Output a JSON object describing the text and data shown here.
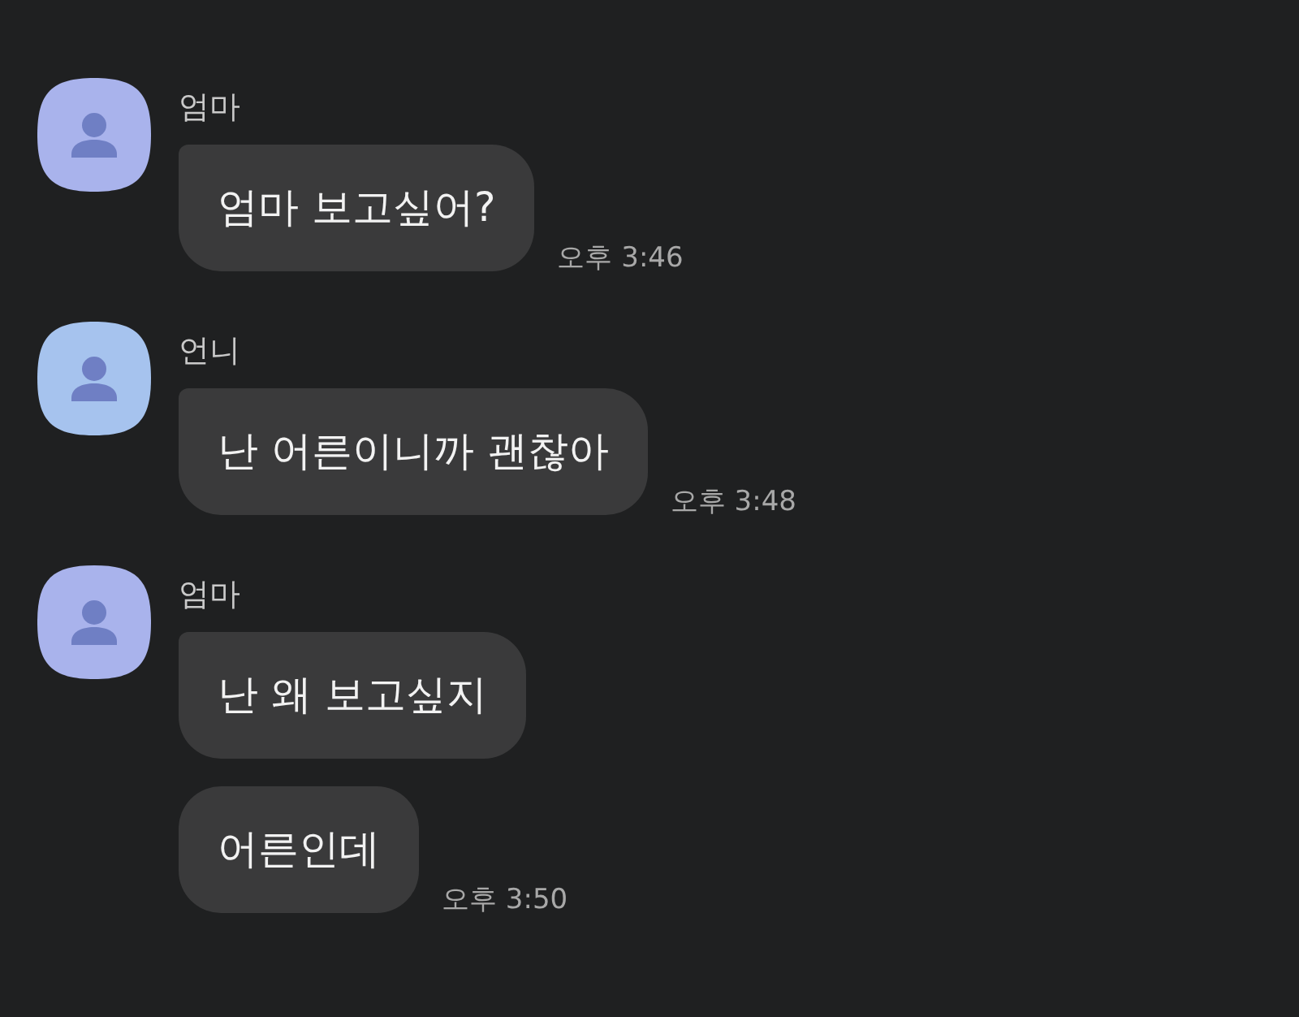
{
  "groups": [
    {
      "sender": "엄마",
      "color": "#a9b3ec",
      "messages": [
        {
          "text": "엄마 보고싶어?",
          "time": "오후 3:46"
        }
      ]
    },
    {
      "sender": "언니",
      "color": "#a6c3ee",
      "messages": [
        {
          "text": "난 어른이니까 괜찮아",
          "time": "오후 3:48"
        }
      ]
    },
    {
      "sender": "엄마",
      "color": "#a9b3ec",
      "messages": [
        {
          "text": "난 왜 보고싶지"
        },
        {
          "text": "어른인데",
          "time": "오후 3:50"
        }
      ]
    }
  ]
}
